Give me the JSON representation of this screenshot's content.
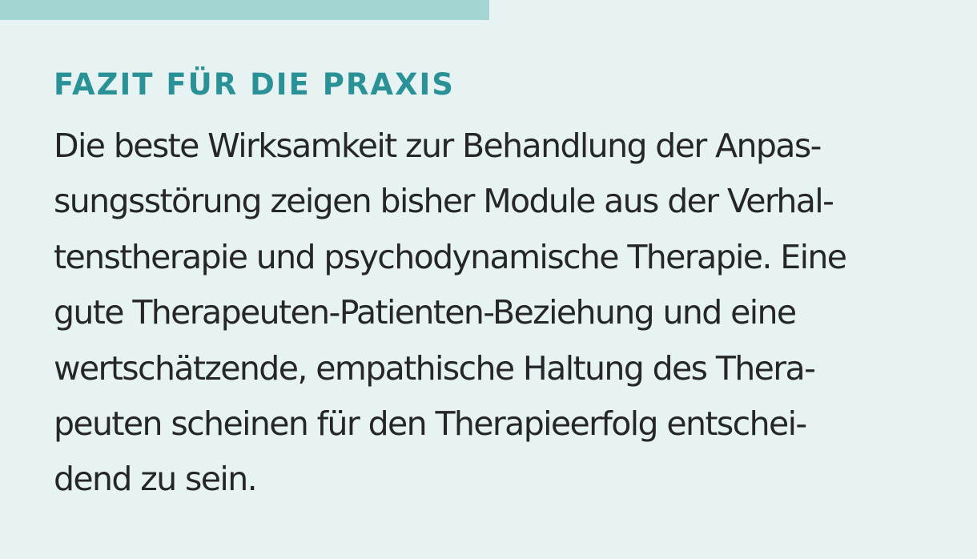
{
  "box": {
    "accent_color": "#2a9297",
    "background_color": "#e6f3f2",
    "top_bar_color": "#a3d6d3",
    "heading": "FAZIT FÜR DIE PRAXIS",
    "body_lines": [
      "Die beste Wirksamkeit zur Behandlung der Anpas-",
      "sungsstörung zeigen bisher Module aus der Verhal-",
      "tenstherapie und psychodynamische Therapie. Eine",
      "gute Therapeuten-Patienten-Beziehung und eine",
      "wertschätzende, empathische Haltung des Thera-",
      "peuten scheinen für den Therapieerfolg entschei-",
      "dend zu sein."
    ]
  }
}
